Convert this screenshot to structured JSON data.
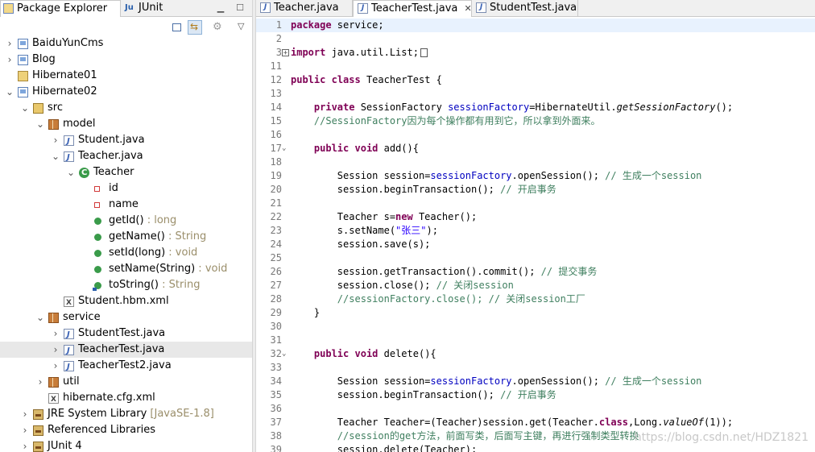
{
  "left_panel": {
    "tabs": [
      {
        "label": "Package Explorer",
        "active": true
      },
      {
        "label": "JUnit",
        "active": false
      }
    ],
    "tree": [
      {
        "label": "BaiduYunCms",
        "depth": 0,
        "toggle": ">",
        "icon": "project-icon"
      },
      {
        "label": "Blog",
        "depth": 0,
        "toggle": ">",
        "icon": "project-icon"
      },
      {
        "label": "Hibernate01",
        "depth": 0,
        "toggle": "",
        "icon": "folder-icon"
      },
      {
        "label": "Hibernate02",
        "depth": 0,
        "toggle": "v",
        "icon": "project-icon"
      },
      {
        "label": "src",
        "depth": 1,
        "toggle": "v",
        "icon": "source-folder-icon"
      },
      {
        "label": "model",
        "depth": 2,
        "toggle": "v",
        "icon": "package-icon"
      },
      {
        "label": "Student.java",
        "depth": 3,
        "toggle": ">",
        "icon": "java-file-icon"
      },
      {
        "label": "Teacher.java",
        "depth": 3,
        "toggle": "v",
        "icon": "java-file-icon"
      },
      {
        "label": "Teacher",
        "depth": 4,
        "toggle": "v",
        "icon": "class-icon"
      },
      {
        "label": "id",
        "depth": 5,
        "toggle": "",
        "icon": "private-field-icon"
      },
      {
        "label": "name",
        "depth": 5,
        "toggle": "",
        "icon": "private-field-icon"
      },
      {
        "label": "getId()",
        "suffix": " : long",
        "depth": 5,
        "toggle": "",
        "icon": "public-method-icon"
      },
      {
        "label": "getName()",
        "suffix": " : String",
        "depth": 5,
        "toggle": "",
        "icon": "public-method-icon"
      },
      {
        "label": "setId(long)",
        "suffix": " : void",
        "depth": 5,
        "toggle": "",
        "icon": "public-method-icon"
      },
      {
        "label": "setName(String)",
        "suffix": " : void",
        "depth": 5,
        "toggle": "",
        "icon": "public-method-icon"
      },
      {
        "label": "toString()",
        "suffix": " : String",
        "depth": 5,
        "toggle": "",
        "icon": "override-method-icon"
      },
      {
        "label": "Student.hbm.xml",
        "depth": 3,
        "toggle": "",
        "icon": "xml-file-icon"
      },
      {
        "label": "service",
        "depth": 2,
        "toggle": "v",
        "icon": "package-icon"
      },
      {
        "label": "StudentTest.java",
        "depth": 3,
        "toggle": ">",
        "icon": "java-file-icon"
      },
      {
        "label": "TeacherTest.java",
        "depth": 3,
        "toggle": ">",
        "icon": "java-file-icon",
        "selected": true
      },
      {
        "label": "TeacherTest2.java",
        "depth": 3,
        "toggle": ">",
        "icon": "java-file-icon"
      },
      {
        "label": "util",
        "depth": 2,
        "toggle": ">",
        "icon": "package-icon"
      },
      {
        "label": "hibernate.cfg.xml",
        "depth": 2,
        "toggle": "",
        "icon": "xml-file-icon"
      },
      {
        "label": "JRE System Library",
        "suffix": " [JavaSE-1.8]",
        "depth": 1,
        "toggle": ">",
        "icon": "library-icon"
      },
      {
        "label": "Referenced Libraries",
        "depth": 1,
        "toggle": ">",
        "icon": "library-icon"
      },
      {
        "label": "JUnit 4",
        "depth": 1,
        "toggle": ">",
        "icon": "library-icon"
      }
    ]
  },
  "editor": {
    "tabs": [
      {
        "label": "Teacher.java",
        "active": false
      },
      {
        "label": "TeacherTest.java",
        "active": true
      },
      {
        "label": "StudentTest.java",
        "active": false
      }
    ],
    "lines": [
      {
        "n": "1",
        "html": "<span class='kw'>package</span> service;"
      },
      {
        "n": "2",
        "html": ""
      },
      {
        "n": "3",
        "fold": "plus",
        "html": "<span class='kw'>import</span> java.util.List;<span class='fold-box'></span>"
      },
      {
        "n": "11",
        "html": ""
      },
      {
        "n": "12",
        "html": "<span class='kw'>public</span> <span class='kw'>class</span> TeacherTest {"
      },
      {
        "n": "13",
        "html": ""
      },
      {
        "n": "14",
        "html": "    <span class='kw'>private</span> SessionFactory <span class='fd'>sessionFactory</span>=HibernateUtil.<span class='it'>getSessionFactory</span>();"
      },
      {
        "n": "15",
        "html": "    <span class='cm'>//SessionFactory因为每个操作都有用到它，所以拿到外面来。</span>"
      },
      {
        "n": "16",
        "html": ""
      },
      {
        "n": "17",
        "fold": "minus",
        "html": "    <span class='kw'>public</span> <span class='kw'>void</span> add(){"
      },
      {
        "n": "18",
        "html": ""
      },
      {
        "n": "19",
        "html": "        Session session=<span class='fd'>sessionFactory</span>.openSession(); <span class='cm'>// 生成一个session</span>"
      },
      {
        "n": "20",
        "html": "        session.beginTransaction(); <span class='cm'>// 开启事务</span>"
      },
      {
        "n": "21",
        "html": ""
      },
      {
        "n": "22",
        "html": "        Teacher s=<span class='kw'>new</span> Teacher();"
      },
      {
        "n": "23",
        "html": "        s.setName(<span class='st'>\"张三\"</span>);"
      },
      {
        "n": "24",
        "html": "        session.save(s);"
      },
      {
        "n": "25",
        "html": ""
      },
      {
        "n": "26",
        "html": "        session.getTransaction().commit(); <span class='cm'>// 提交事务</span>"
      },
      {
        "n": "27",
        "html": "        session.close(); <span class='cm'>// 关闭session</span>"
      },
      {
        "n": "28",
        "html": "        <span class='cm'>//sessionFactory.close(); // 关闭session工厂</span>"
      },
      {
        "n": "29",
        "html": "    }"
      },
      {
        "n": "30",
        "html": ""
      },
      {
        "n": "31",
        "html": ""
      },
      {
        "n": "32",
        "fold": "minus",
        "html": "    <span class='kw'>public</span> <span class='kw'>void</span> delete(){"
      },
      {
        "n": "33",
        "html": ""
      },
      {
        "n": "34",
        "html": "        Session session=<span class='fd'>sessionFactory</span>.openSession(); <span class='cm'>// 生成一个session</span>"
      },
      {
        "n": "35",
        "html": "        session.beginTransaction(); <span class='cm'>// 开启事务</span>"
      },
      {
        "n": "36",
        "html": ""
      },
      {
        "n": "37",
        "html": "        Teacher Teacher=(Teacher)session.get(Teacher.<span class='kw'>class</span>,Long.<span class='it'>valueOf</span>(1));"
      },
      {
        "n": "38",
        "html": "        <span class='cm'>//session的get方法，前面写类，后面写主键，再进行强制类型转换</span>"
      },
      {
        "n": "39",
        "html": "        session.delete(Teacher);"
      }
    ]
  },
  "watermark": "https://blog.csdn.net/HDZ1821"
}
